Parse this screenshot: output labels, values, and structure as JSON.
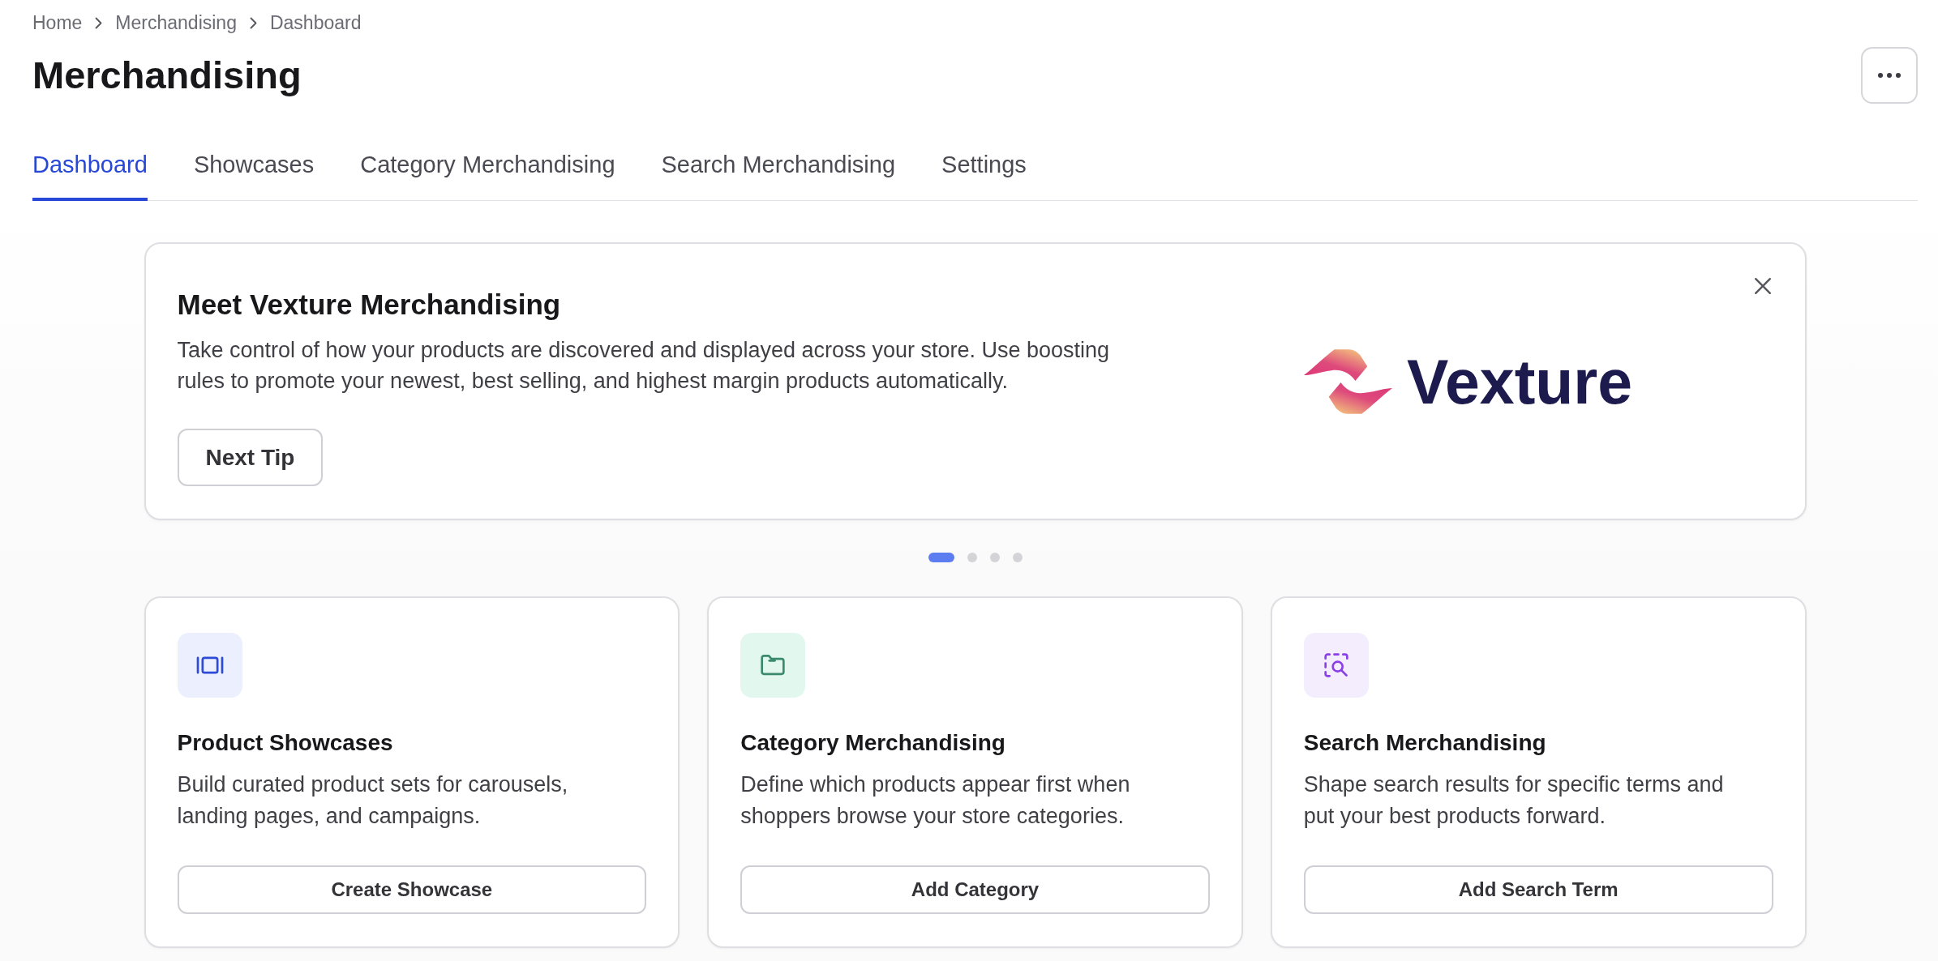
{
  "breadcrumb": [
    "Home",
    "Merchandising",
    "Dashboard"
  ],
  "title": "Merchandising",
  "tabs": [
    {
      "label": "Dashboard",
      "selected": true
    },
    {
      "label": "Showcases",
      "selected": false
    },
    {
      "label": "Category Merchandising",
      "selected": false
    },
    {
      "label": "Search Merchandising",
      "selected": false
    },
    {
      "label": "Settings",
      "selected": false
    }
  ],
  "banner": {
    "title": "Meet Vexture Merchandising",
    "text": "Take control of how your products are discovered and displayed across your store. Use boosting rules to promote your newest, best selling, and highest margin products automatically.",
    "button": "Next Tip",
    "logo_text": "Vexture"
  },
  "slides": [
    {
      "selected": true
    },
    {
      "selected": false
    },
    {
      "selected": false
    },
    {
      "selected": false
    }
  ],
  "cards": [
    {
      "kind": "showcase",
      "title": "Product Showcases",
      "description": "Build curated product sets for carousels, landing pages, and campaigns.",
      "button": "Create Showcase"
    },
    {
      "kind": "category",
      "title": "Category Merchandising",
      "description": "Define which products appear first when shoppers browse your store categories.",
      "button": "Add Category"
    },
    {
      "kind": "search",
      "title": "Search Merchandising",
      "description": "Shape search results for specific terms and put your best products forward.",
      "button": "Add Search Term"
    }
  ]
}
